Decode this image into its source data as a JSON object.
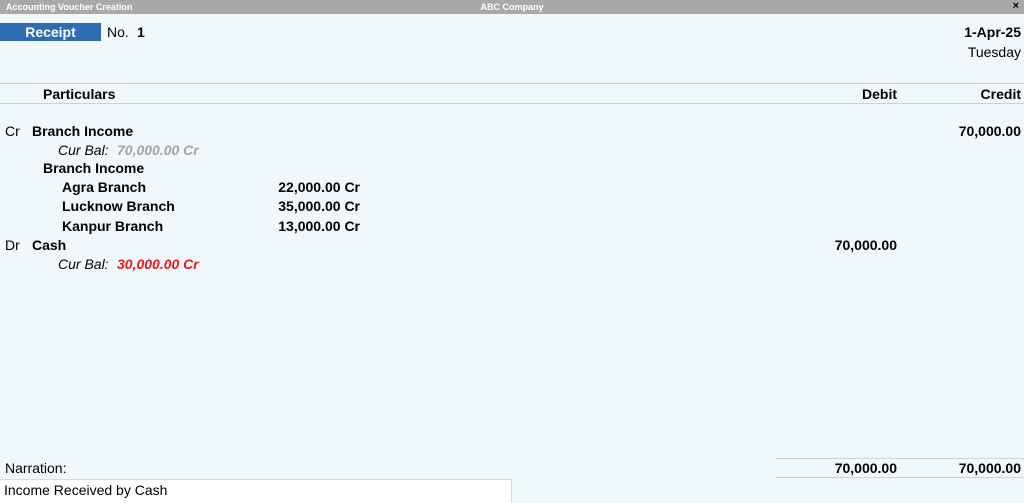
{
  "window": {
    "title": "Accounting Voucher Creation",
    "company": "ABC Company",
    "close_glyph": "×"
  },
  "voucher": {
    "type": "Receipt",
    "no_label": "No.",
    "number": "1",
    "date": "1-Apr-25",
    "day": "Tuesday"
  },
  "columns": {
    "particulars": "Particulars",
    "debit": "Debit",
    "credit": "Credit"
  },
  "entries": [
    {
      "drcr": "Cr",
      "ledger": "Branch Income",
      "amount_credit": "70,000.00",
      "cur_bal_label": "Cur Bal:",
      "cur_bal": "70,000.00 Cr",
      "cost_category": "Branch Income",
      "cost_centres": [
        {
          "name": "Agra Branch",
          "amount": "22,000.00 Cr"
        },
        {
          "name": "Lucknow Branch",
          "amount": "35,000.00 Cr"
        },
        {
          "name": "Kanpur Branch",
          "amount": "13,000.00 Cr"
        }
      ]
    },
    {
      "drcr": "Dr",
      "ledger": "Cash",
      "amount_debit": "70,000.00",
      "cur_bal_label": "Cur Bal:",
      "cur_bal": "30,000.00 Cr"
    }
  ],
  "narration": {
    "label": "Narration:",
    "text": "Income Received by Cash"
  },
  "totals": {
    "debit": "70,000.00",
    "credit": "70,000.00"
  },
  "colors": {
    "background": "#f0f8fc",
    "voucher_type_bg": "#2e6db4",
    "cur_bal_positive": "#a3a3a3",
    "cur_bal_alert": "#e51d1d"
  }
}
